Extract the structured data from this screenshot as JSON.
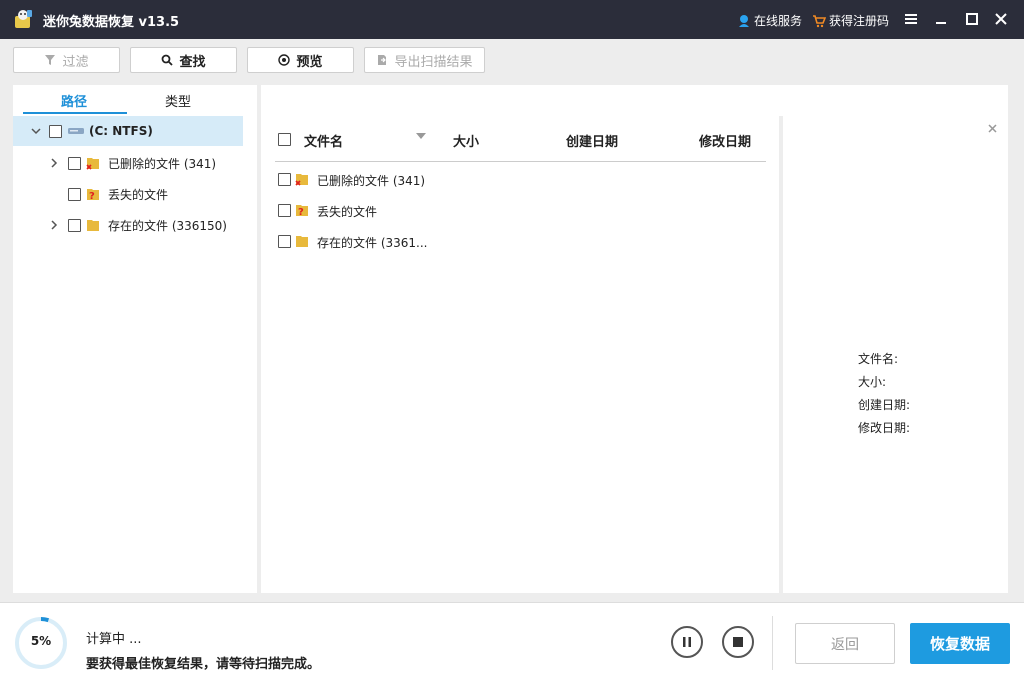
{
  "window": {
    "title": "迷你兔数据恢复 v13.5",
    "online_service": "在线服务",
    "get_code": "获得注册码"
  },
  "toolbar": {
    "filter": "过滤",
    "search": "查找",
    "preview": "预览",
    "export": "导出扫描结果"
  },
  "tabs": {
    "path": "路径",
    "type": "类型"
  },
  "tree": {
    "drive": "(C: NTFS)",
    "deleted": "已删除的文件 (341)",
    "lost": "丢失的文件",
    "existing": "存在的文件 (336150)"
  },
  "columns": {
    "name": "文件名",
    "size": "大小",
    "created": "创建日期",
    "modified": "修改日期"
  },
  "files": {
    "deleted": "已删除的文件 (341)",
    "lost": "丢失的文件",
    "existing": "存在的文件 (3361..."
  },
  "details": {
    "name": "文件名:",
    "size": "大小:",
    "created": "创建日期:",
    "modified": "修改日期:"
  },
  "status": {
    "progress_label": "5%",
    "progress_value": 0.05,
    "line1": "计算中 ...",
    "line2": "要获得最佳恢复结果，请等待扫描完成。"
  },
  "buttons": {
    "back": "返回",
    "recover": "恢复数据"
  },
  "colors": {
    "accent": "#1e90d8",
    "titlebar": "#2b2d3a"
  }
}
